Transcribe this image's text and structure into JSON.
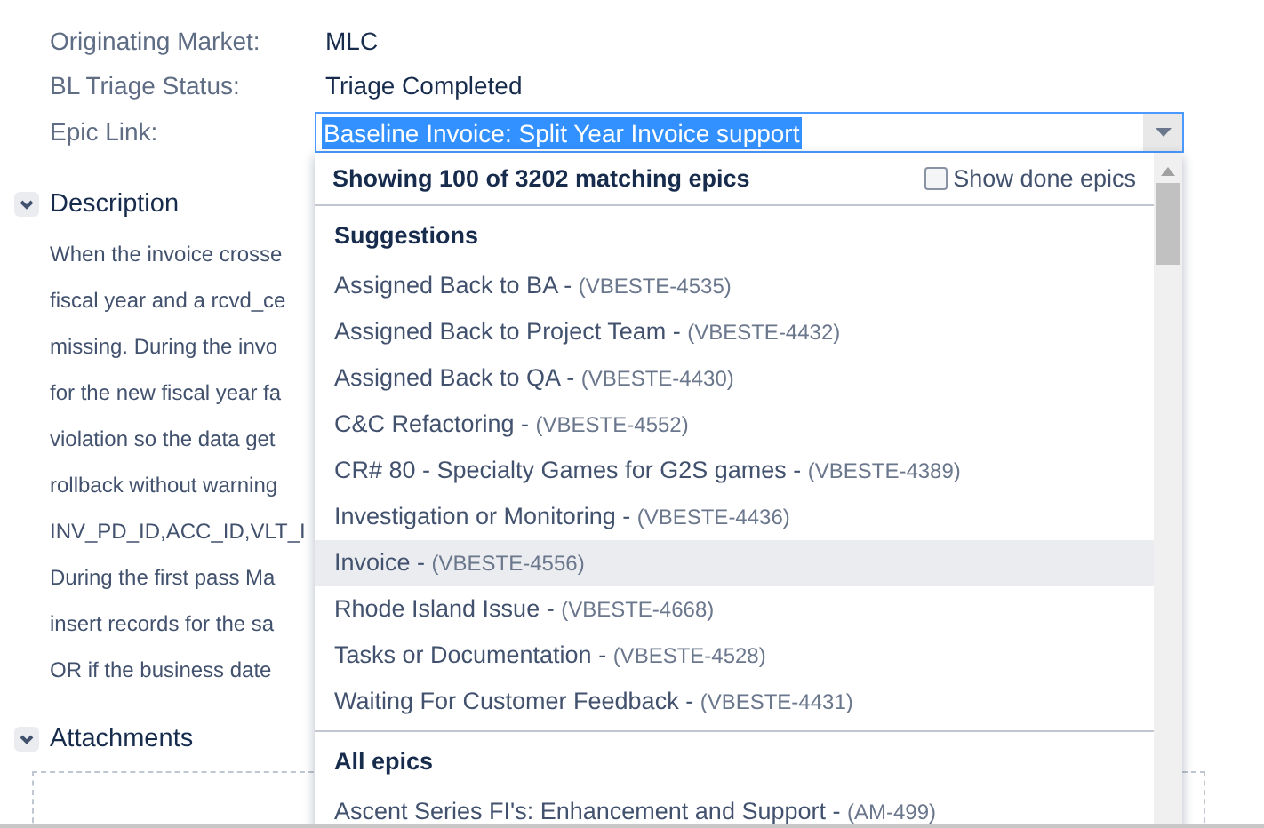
{
  "fields": [
    {
      "label": "Originating Market:",
      "value": "MLC"
    },
    {
      "label": "BL Triage Status:",
      "value": "Triage Completed"
    }
  ],
  "epic_link": {
    "label": "Epic Link:",
    "value": "Baseline Invoice: Split Year Invoice support"
  },
  "dropdown": {
    "summary": "Showing 100 of 3202 matching epics",
    "show_done": {
      "label": "Show done epics",
      "checked": false
    },
    "groups": [
      {
        "heading": "Suggestions",
        "items": [
          {
            "name": "Assigned Back to BA - ",
            "key": "(VBESTE-4535)",
            "selected": false
          },
          {
            "name": "Assigned Back to Project Team - ",
            "key": "(VBESTE-4432)",
            "selected": false
          },
          {
            "name": "Assigned Back to QA - ",
            "key": "(VBESTE-4430)",
            "selected": false
          },
          {
            "name": "C&C Refactoring - ",
            "key": "(VBESTE-4552)",
            "selected": false
          },
          {
            "name": "CR# 80 - Specialty Games for G2S games - ",
            "key": "(VBESTE-4389)",
            "selected": false
          },
          {
            "name": "Investigation or Monitoring - ",
            "key": "(VBESTE-4436)",
            "selected": false
          },
          {
            "name": "Invoice - ",
            "key": "(VBESTE-4556)",
            "selected": true
          },
          {
            "name": "Rhode Island Issue - ",
            "key": "(VBESTE-4668)",
            "selected": false
          },
          {
            "name": "Tasks or Documentation - ",
            "key": "(VBESTE-4528)",
            "selected": false
          },
          {
            "name": "Waiting For Customer Feedback - ",
            "key": "(VBESTE-4431)",
            "selected": false
          }
        ]
      },
      {
        "heading": "All epics",
        "items": [
          {
            "name": "Ascent Series FI's: Enhancement and Support - ",
            "key": "(AM-499)",
            "selected": false
          }
        ]
      }
    ]
  },
  "description": {
    "heading": "Description",
    "expanded": true,
    "lines": [
      "When the invoice crosse",
      "fiscal year and a rcvd_ce",
      "missing. During the invo",
      "for the new fiscal year fa",
      "violation so the data get",
      "rollback without warning",
      "INV_PD_ID,ACC_ID,VLT_I",
      "During the first pass Ma",
      "insert records for the sa",
      "OR if the business date"
    ]
  },
  "attachments": {
    "heading": "Attachments",
    "expanded": true
  }
}
